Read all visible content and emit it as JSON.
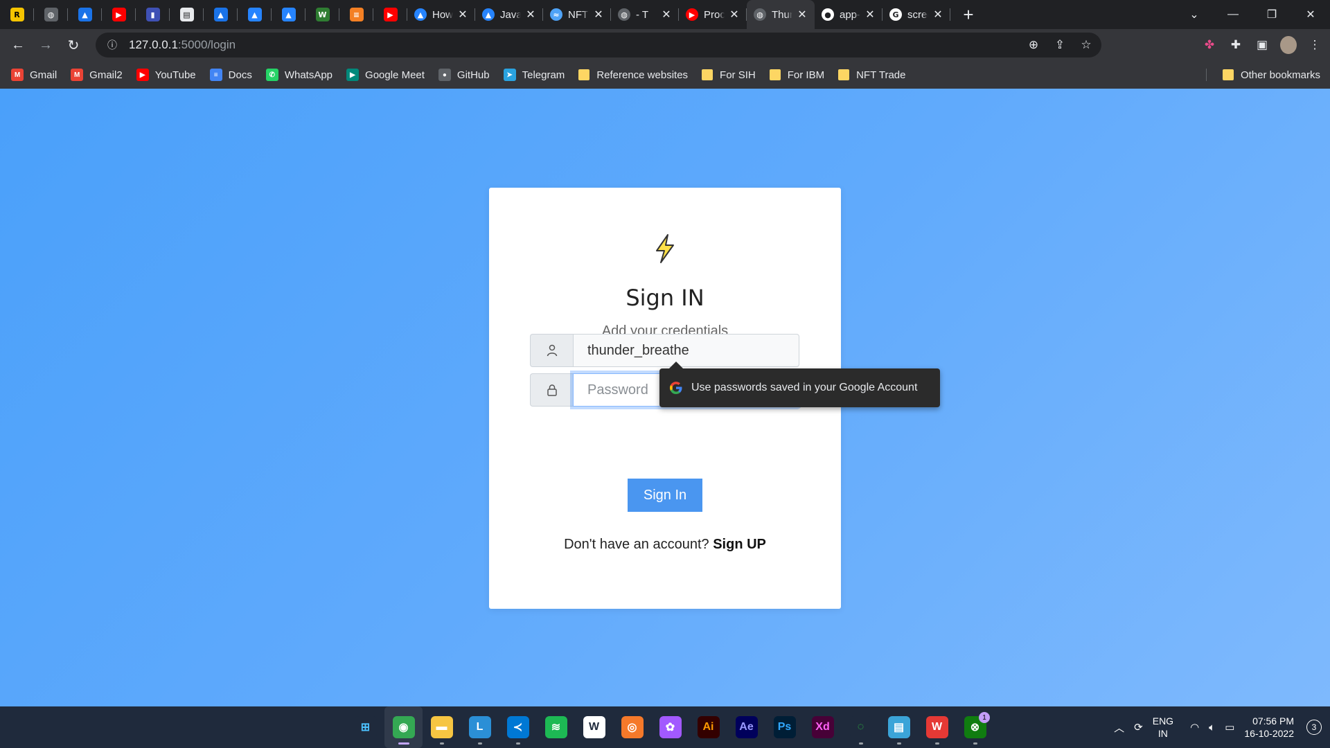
{
  "browser": {
    "pinned_tabs": [
      {
        "icon": "replit-icon",
        "glyph": "R",
        "color": "#f5c400",
        "fg": "#000"
      },
      {
        "icon": "globe-icon",
        "glyph": "◍",
        "color": "#5f6368",
        "fg": "#fff"
      },
      {
        "icon": "drive-icon",
        "glyph": "▲",
        "color": "#1a73e8",
        "fg": "#fff"
      },
      {
        "icon": "youtube-icon",
        "glyph": "▶",
        "color": "#ff0000",
        "fg": "#fff"
      },
      {
        "icon": "chart-icon",
        "glyph": "▮",
        "color": "#3f51b5",
        "fg": "#fff"
      },
      {
        "icon": "doc-icon",
        "glyph": "▤",
        "color": "#e8eaed",
        "fg": "#202124"
      },
      {
        "icon": "drive-icon",
        "glyph": "▲",
        "color": "#1a73e8",
        "fg": "#fff"
      },
      {
        "icon": "atlassian-icon",
        "glyph": "▲",
        "color": "#2684ff",
        "fg": "#fff"
      },
      {
        "icon": "atlassian-icon",
        "glyph": "▲",
        "color": "#2684ff",
        "fg": "#fff"
      },
      {
        "icon": "webflow-icon",
        "glyph": "W",
        "color": "#2f7d32",
        "fg": "#fff"
      },
      {
        "icon": "stackoverflow-icon",
        "glyph": "≡",
        "color": "#f48024",
        "fg": "#fff"
      },
      {
        "icon": "youtube-icon",
        "glyph": "▶",
        "color": "#ff0000",
        "fg": "#fff"
      }
    ],
    "tabs": [
      {
        "title": "How to",
        "icon": "atlassian-icon",
        "glyph": "▲",
        "color": "#2684ff",
        "active": false
      },
      {
        "title": "JavaSc",
        "icon": "atlassian-icon",
        "glyph": "▲",
        "color": "#2684ff",
        "active": false
      },
      {
        "title": "NFT Sa",
        "icon": "waves-icon",
        "glyph": "≈",
        "color": "#4fa3f7",
        "active": false
      },
      {
        "title": "- T",
        "icon": "globe-icon",
        "glyph": "◍",
        "color": "#5f6368",
        "active": false
      },
      {
        "title": "Procec",
        "icon": "youtube-icon",
        "glyph": "▶",
        "color": "#ff0000",
        "active": false
      },
      {
        "title": "Thund",
        "icon": "globe-icon",
        "glyph": "◍",
        "color": "#5f6368",
        "active": true
      },
      {
        "title": "app-g",
        "icon": "github-icon",
        "glyph": "●",
        "color": "#ffffff",
        "active": false
      },
      {
        "title": "screen",
        "icon": "google-icon",
        "glyph": "G",
        "color": "#ffffff",
        "active": false
      }
    ],
    "url_host": "127.0.0.1",
    "url_path": ":5000/login",
    "bookmarks": [
      {
        "label": "Gmail",
        "icon": "gmail-icon",
        "glyph": "M",
        "color": "#ea4335"
      },
      {
        "label": "Gmail2",
        "icon": "gmail-icon",
        "glyph": "M",
        "color": "#ea4335"
      },
      {
        "label": "YouTube",
        "icon": "youtube-icon",
        "glyph": "▶",
        "color": "#ff0000"
      },
      {
        "label": "Docs",
        "icon": "docs-icon",
        "glyph": "≡",
        "color": "#4285f4"
      },
      {
        "label": "WhatsApp",
        "icon": "whatsapp-icon",
        "glyph": "✆",
        "color": "#25d366"
      },
      {
        "label": "Google Meet",
        "icon": "meet-icon",
        "glyph": "▶",
        "color": "#00897b"
      },
      {
        "label": "GitHub",
        "icon": "github-icon",
        "glyph": "●",
        "color": "#5f6368"
      },
      {
        "label": "Telegram",
        "icon": "telegram-icon",
        "glyph": "➤",
        "color": "#2aa3e0"
      },
      {
        "label": "Reference websites",
        "icon": "folder-icon",
        "folder": true
      },
      {
        "label": "For SIH",
        "icon": "folder-icon",
        "folder": true
      },
      {
        "label": "For IBM",
        "icon": "folder-icon",
        "folder": true
      },
      {
        "label": "NFT Trade",
        "icon": "folder-icon",
        "folder": true
      }
    ],
    "other_bookmarks": "Other bookmarks"
  },
  "login": {
    "title": "Sign IN",
    "subtitle": "Add your credentials",
    "username_value": "thunder_breathe",
    "password_placeholder": "Password",
    "button_label": "Sign In",
    "signup_prompt": "Don't have an account?",
    "signup_link": "Sign UP",
    "accent": "#4a96f0"
  },
  "password_tooltip": "Use passwords saved in your Google Account",
  "taskbar": {
    "apps": [
      {
        "icon": "windows-start-icon",
        "glyph": "⊞",
        "color": "#1f2a3c",
        "fg": "#4cc2ff"
      },
      {
        "icon": "chrome-icon",
        "glyph": "◉",
        "color": "#34a853",
        "active": true
      },
      {
        "icon": "file-explorer-icon",
        "glyph": "▬",
        "color": "#f6c542",
        "dot": true
      },
      {
        "icon": "launcher-icon",
        "glyph": "L",
        "color": "#2b8fd6",
        "dot": true
      },
      {
        "icon": "vscode-icon",
        "glyph": "≺",
        "color": "#0078d4",
        "dot": true
      },
      {
        "icon": "spotify-icon",
        "glyph": "≋",
        "color": "#1db954"
      },
      {
        "icon": "app-icon",
        "glyph": "W",
        "color": "#ffffff",
        "fg": "#1f2a3c"
      },
      {
        "icon": "blender-icon",
        "glyph": "◎",
        "color": "#f5792a"
      },
      {
        "icon": "figma-icon",
        "glyph": "✿",
        "color": "#a259ff"
      },
      {
        "icon": "illustrator-icon",
        "glyph": "Ai",
        "color": "#330000",
        "fg": "#ff9a00"
      },
      {
        "icon": "after-effects-icon",
        "glyph": "Ae",
        "color": "#00005b",
        "fg": "#9999ff"
      },
      {
        "icon": "photoshop-icon",
        "glyph": "Ps",
        "color": "#001e36",
        "fg": "#31a8ff"
      },
      {
        "icon": "xd-icon",
        "glyph": "Xd",
        "color": "#470137",
        "fg": "#ff61f6"
      },
      {
        "icon": "loader-icon",
        "glyph": "◌",
        "color": "#1f2a3c",
        "fg": "#2ecc40",
        "dot": true
      },
      {
        "icon": "notepad-icon",
        "glyph": "▤",
        "color": "#3ba4d8",
        "dot": true
      },
      {
        "icon": "wps-icon",
        "glyph": "W",
        "color": "#e53935",
        "dot": true
      },
      {
        "icon": "xbox-icon",
        "glyph": "⊗",
        "color": "#107c10",
        "badge": "1",
        "dot": true
      }
    ],
    "lang_top": "ENG",
    "lang_bottom": "IN",
    "time": "07:56 PM",
    "date": "16-10-2022",
    "notifications": "3"
  }
}
